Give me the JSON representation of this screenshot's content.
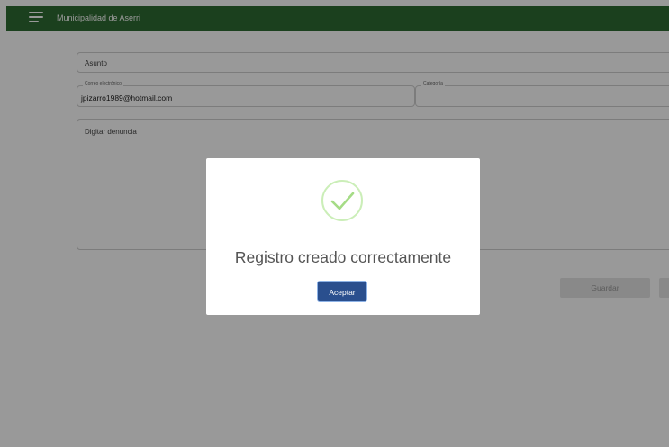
{
  "header": {
    "title": "Municipalidad de Aserri",
    "menu_icon": "menu-icon"
  },
  "form": {
    "subject_placeholder": "Asunto",
    "email_label": "Correo electrónico",
    "email_value": "jpizarro1989@hotmail.com",
    "category_label": "Categoría",
    "complaint_placeholder": "Digitar denuncia",
    "save_label": "Guardar"
  },
  "modal": {
    "icon": "success-check-icon",
    "message": "Registro creado correctamente",
    "ok_label": "Aceptar"
  },
  "colors": {
    "header_bg": "#2e6b33",
    "primary_button": "#2a4f8e",
    "success_green": "#a5dc86"
  }
}
